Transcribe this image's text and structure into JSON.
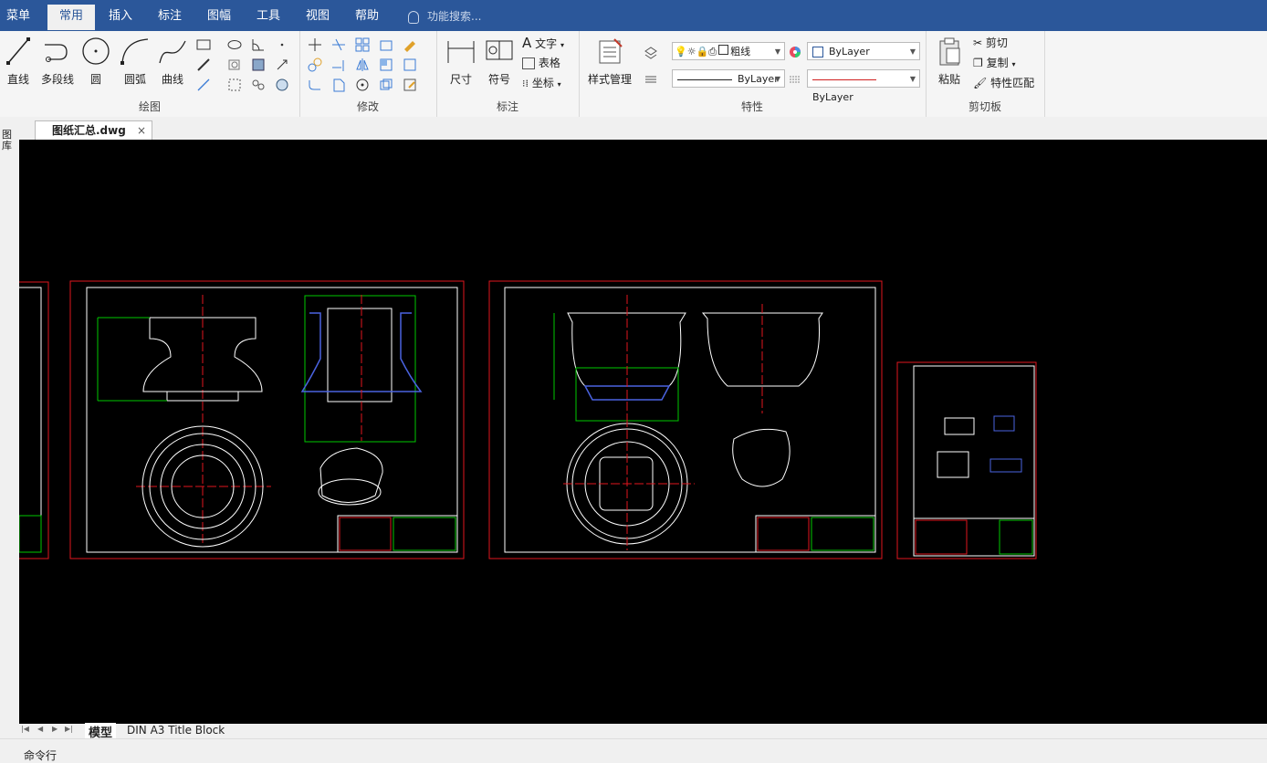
{
  "menu": {
    "tabs": [
      {
        "label": "菜单"
      },
      {
        "label": "常用"
      },
      {
        "label": "插入"
      },
      {
        "label": "标注"
      },
      {
        "label": "图幅"
      },
      {
        "label": "工具"
      },
      {
        "label": "视图"
      },
      {
        "label": "帮助"
      }
    ],
    "active_tab": "常用",
    "search_placeholder": "功能搜索..."
  },
  "ribbon": {
    "draw": {
      "label": "绘图",
      "line": "直线",
      "polyline": "多段线",
      "circle": "圆",
      "arc": "圆弧",
      "curve": "曲线"
    },
    "modify": {
      "label": "修改"
    },
    "annotate": {
      "label": "标注",
      "dimension": "尺寸",
      "symbol": "符号",
      "text": "文字",
      "table": "表格",
      "coordinate": "坐标"
    },
    "properties": {
      "label": "特性",
      "style_manager": "样式管理",
      "layer_name": "粗线",
      "color": "ByLayer",
      "linetype": "ByLayer",
      "lineweight": "ByLayer"
    },
    "clipboard": {
      "label": "剪切板",
      "paste": "粘贴",
      "cut": "剪切",
      "copy": "复制",
      "match_properties": "特性匹配"
    }
  },
  "document": {
    "tab_label": "图纸汇总.dwg",
    "close_symbol": "×"
  },
  "left_strip_label": "图库",
  "layout_tabs": {
    "nav": [
      "|◀",
      "◀",
      "▶",
      "▶|"
    ],
    "model": "模型",
    "layout": "DIN A3 Title Block"
  },
  "command_line": {
    "label": "命令行"
  },
  "colors": {
    "menubar": "#2b579a",
    "canvas": "#000000",
    "frame_red": "#e0161e",
    "drawing_white": "#ffffff",
    "dim_green": "#00c800"
  }
}
